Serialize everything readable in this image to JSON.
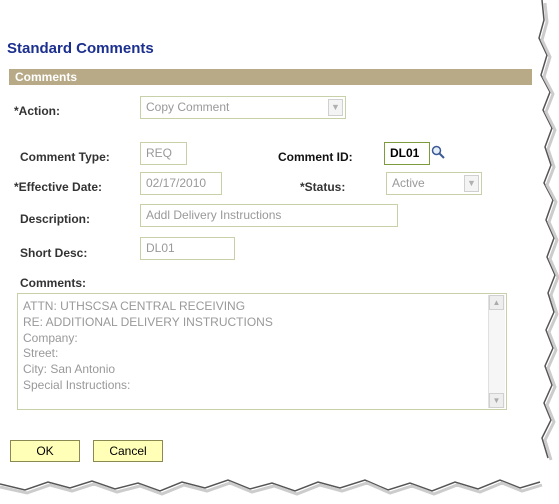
{
  "title": "Standard Comments",
  "section": {
    "label": "Comments"
  },
  "action": {
    "label": "*Action:",
    "value": "Copy Comment"
  },
  "comment_type": {
    "label": "Comment Type:",
    "value": "REQ"
  },
  "comment_id": {
    "label": "Comment ID:",
    "value": "DL01",
    "icon": "search-icon"
  },
  "effective_date": {
    "label": "*Effective Date:",
    "value": "02/17/2010"
  },
  "status": {
    "label": "*Status:",
    "value": "Active"
  },
  "description": {
    "label": "Description:",
    "value": "Addl Delivery Instructions"
  },
  "short_desc": {
    "label": "Short Desc:",
    "value": "DL01"
  },
  "comments": {
    "label": "Comments:",
    "lines": [
      "ATTN: UTHSCSA CENTRAL RECEIVING",
      "RE: ADDITIONAL DELIVERY INSTRUCTIONS",
      "Company:",
      "Street:",
      "City: San Antonio",
      "Special Instructions:"
    ]
  },
  "buttons": {
    "ok": "OK",
    "cancel": "Cancel"
  },
  "colors": {
    "title": "#1b2f8f",
    "section_bar": "#b8aa86",
    "button_bg": "#ffffb8",
    "field_border": "#c8d0a8"
  }
}
